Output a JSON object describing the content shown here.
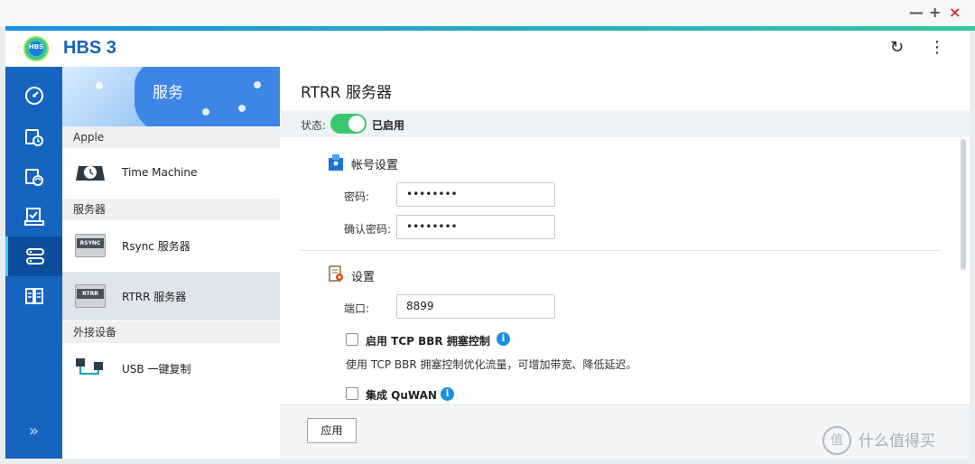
{
  "window_controls": {
    "minimize": "—",
    "maximize": "+",
    "close": "×"
  },
  "header": {
    "logo_text": "HBS",
    "app_title": "HBS 3",
    "refresh_icon": "↻",
    "more_icon": "⋮"
  },
  "leftnav": {
    "more_label": "»"
  },
  "service_panel": {
    "banner_title": "服务",
    "groups": [
      {
        "header": "Apple",
        "items": [
          {
            "label": "Time Machine"
          }
        ]
      },
      {
        "header": "服务器",
        "items": [
          {
            "label": "Rsync 服务器",
            "badge": "RSYNC"
          },
          {
            "label": "RTRR 服务器",
            "badge": "RTRR"
          }
        ]
      },
      {
        "header": "外接设备",
        "items": [
          {
            "label": "USB 一键复制"
          }
        ]
      }
    ]
  },
  "main": {
    "title": "RTRR 服务器",
    "status_label": "状态:",
    "status_value": "已启用",
    "account_section": {
      "title": "帐号设置",
      "password_label": "密码:",
      "password_value": "••••••••",
      "confirm_label": "确认密码:",
      "confirm_value": "••••••••"
    },
    "settings_section": {
      "title": "设置",
      "port_label": "端口:",
      "port_value": "8899",
      "bbr_label": "启用 TCP BBR 拥塞控制",
      "bbr_desc": "使用 TCP BBR 拥塞控制优化流量，可增加带宽、降低延迟。",
      "quwan_label": "集成 QuWAN",
      "info_glyph": "i"
    },
    "apply_label": "应用"
  },
  "watermark": {
    "text": "什么值得买",
    "icon": "值"
  },
  "colors": {
    "brand_blue": "#1565c0",
    "toggle_on": "#3cc56f",
    "info_blue": "#1a8fe3",
    "title_blue": "#1a62b8"
  }
}
